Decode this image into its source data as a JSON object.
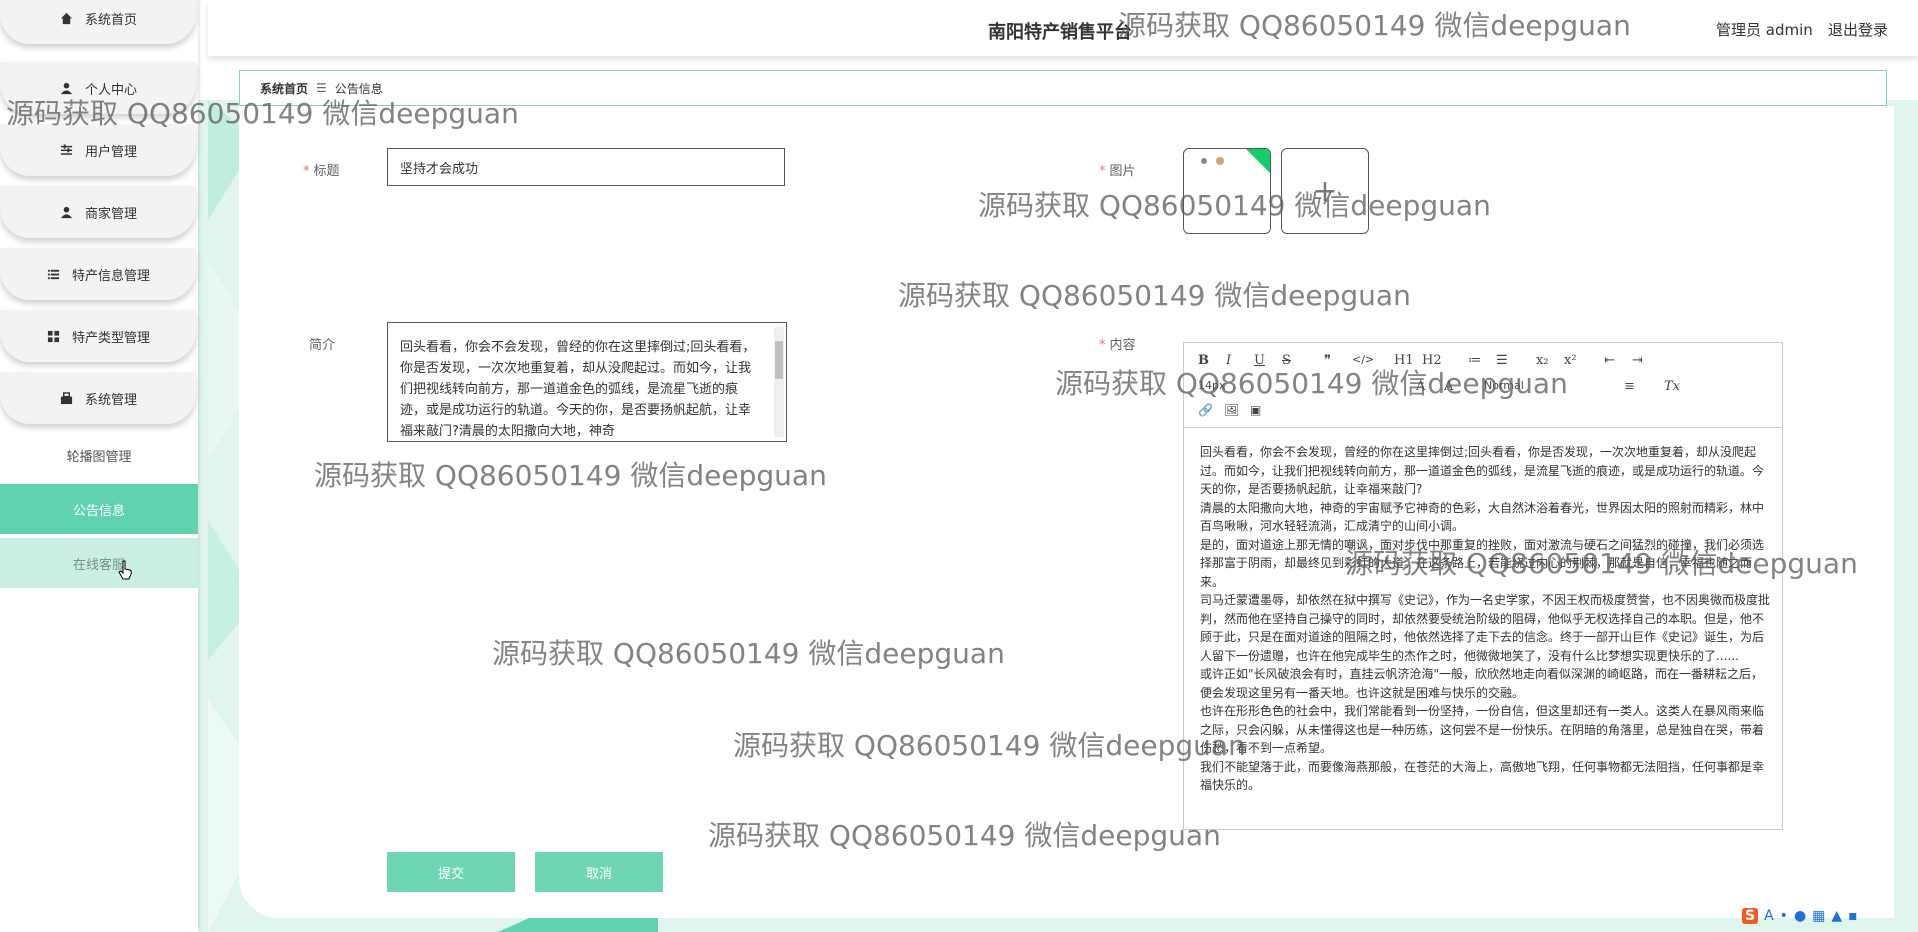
{
  "sidebar": {
    "items": [
      {
        "label": "系统首页",
        "icon": "home-icon"
      },
      {
        "label": "个人中心",
        "icon": "user-icon"
      },
      {
        "label": "用户管理",
        "icon": "sliders-icon"
      },
      {
        "label": "商家管理",
        "icon": "user-icon"
      },
      {
        "label": "特产信息管理",
        "icon": "list-icon"
      },
      {
        "label": "特产类型管理",
        "icon": "grid-icon"
      },
      {
        "label": "系统管理",
        "icon": "settings-icon"
      }
    ],
    "sub_items": [
      {
        "label": "轮播图管理"
      },
      {
        "label": "公告信息"
      },
      {
        "label": "在线客服"
      }
    ]
  },
  "header": {
    "title": "南阳特产销售平台",
    "admin_text": "管理员 admin",
    "logout": "退出登录"
  },
  "breadcrumb": {
    "home": "系统首页",
    "separator": "☰",
    "current": "公告信息"
  },
  "form": {
    "title_label": "标题",
    "title_value": "坚持才会成功",
    "image_label": "图片",
    "summary_label": "简介",
    "summary_value": "回头看看，你会不会发现，曾经的你在这里摔倒过;回头看看，你是否发现，一次次地重复着，却从没爬起过。而如今，让我们把视线转向前方，那一道道金色的弧线，是流星飞逝的痕迹，或是成功运行的轨道。今天的你，是否要扬帆起航，让幸福来敲门?清晨的太阳撒向大地，神奇",
    "content_label": "内容",
    "content_paragraphs": [
      "回头看看，你会不会发现，曾经的你在这里摔倒过;回头看看，你是否发现，一次次地重复着，却从没爬起过。而如今，让我们把视线转向前方，那一道道金色的弧线，是流星飞逝的痕迹，或是成功运行的轨道。今天的你，是否要扬帆起航，让幸福来敲门?",
      "清晨的太阳撒向大地，神奇的宇宙赋予它神奇的色彩，大自然沐浴着春光，世界因太阳的照射而精彩，林中百鸟啾啾，河水轻轻流淌，汇成清宁的山间小调。",
      "是的，面对道途上那无情的嘲讽，面对步伐中那重复的挫败，面对激流与硬石之间猛烈的碰撞，我们必须选择那富于阴雨，却最终见到彩虹的大道。在这条路上，若能绕过内心的荆棘，那就是自信，幸福也随之而来。",
      "司马迁蒙遭墨辱，却依然在狱中撰写《史记》，作为一名史学家，不因王权而极度赞誉，也不因奥微而极度批判，然而他在坚持自己操守的同时，却依然要受统治阶级的阻碍，他似乎无权选择自己的本职。但是，他不顾于此，只是在面对道途的阻隔之时，他依然选择了走下去的信念。终于一部开山巨作《史记》诞生，为后人留下一份遗赠，也许在他完成毕生的杰作之时，他微微地笑了，没有什么比梦想实现更快乐的了......",
      "或许正如\"长风破浪会有时，直挂云帆济沧海\"一般，欣欣然地走向看似深渊的崎岖路，而在一番耕耘之后，便会发现这里另有一番天地。也许这就是困难与快乐的交融。",
      "也许在形形色色的社会中，我们常能看到一份坚持，一份自信，但这里却还有一类人。这类人在暴风雨来临之际，只会闪躲，从未懂得这也是一种历练，这何尝不是一份快乐。在阴暗的角落里，总是独自在哭，带着伤愁，看不到一点希望。",
      "我们不能望落于此，而要像海燕那般，在苍茫的大海上，高傲地飞翔，任何事物都无法阻挡，任何事都是幸福快乐的。"
    ],
    "submit": "提交",
    "cancel": "取消"
  },
  "editor_toolbar": [
    "B",
    "I",
    "U",
    "S",
    "❞",
    "</>",
    "H1",
    "H2",
    "≔",
    "☰",
    "x₂",
    "x²",
    "⇤",
    "⇥",
    "14px",
    "Normal",
    "A",
    "A",
    "≡",
    "Tx",
    "🔗",
    "🖼",
    "▣"
  ],
  "watermark": "源码获取 QQ86050149 微信deepguan",
  "colors": {
    "accent": "#5fd3b0",
    "accent_soft": "#c9efe3",
    "required": "#f56c6c"
  }
}
